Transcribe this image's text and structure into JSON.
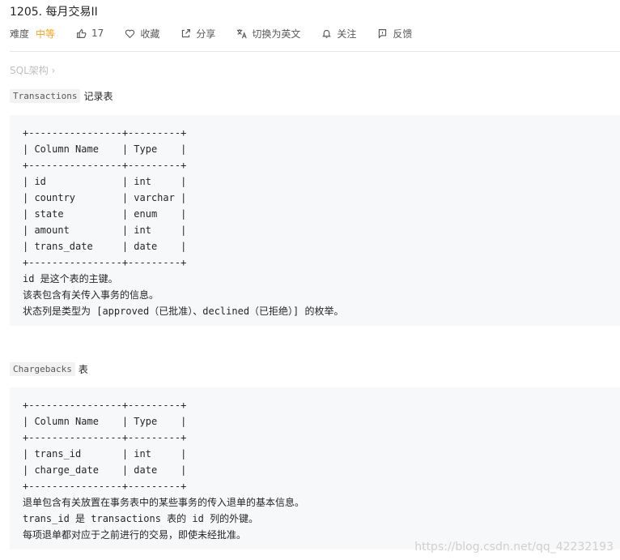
{
  "problem": {
    "title": "1205. 每月交易II"
  },
  "meta": {
    "difficulty_label": "难度",
    "difficulty_value": "中等",
    "likes": "17",
    "favorite": "收藏",
    "share": "分享",
    "switch_lang": "切换为英文",
    "follow": "关注",
    "feedback": "反馈"
  },
  "breadcrumb": "SQL架构 ›",
  "transactions": {
    "name": "Transactions",
    "suffix": "记录表",
    "schema": [
      "+----------------+---------+",
      "| Column Name    | Type    |",
      "+----------------+---------+",
      "| id             | int     |",
      "| country        | varchar |",
      "| state          | enum    |",
      "| amount         | int     |",
      "| trans_date     | date    |",
      "+----------------+---------+"
    ],
    "notes": [
      "id 是这个表的主键。",
      "该表包含有关传入事务的信息。",
      "状态列是类型为 [approved（已批准）、declined（已拒绝）] 的枚举。"
    ]
  },
  "chargebacks": {
    "name": "Chargebacks",
    "suffix": "表",
    "schema": [
      "+----------------+---------+",
      "| Column Name    | Type    |",
      "+----------------+---------+",
      "| trans_id       | int     |",
      "| charge_date    | date    |",
      "+----------------+---------+"
    ],
    "notes": [
      "退单包含有关放置在事务表中的某些事务的传入退单的基本信息。",
      "trans_id 是 transactions 表的 id 列的外键。",
      "每项退单都对应于之前进行的交易，即使未经批准。"
    ]
  },
  "watermark": "https://blog.csdn.net/qq_42232193",
  "icons": [
    "thumbs-up-icon",
    "heart-icon",
    "share-icon",
    "translate-icon",
    "bell-icon",
    "flag-icon"
  ]
}
